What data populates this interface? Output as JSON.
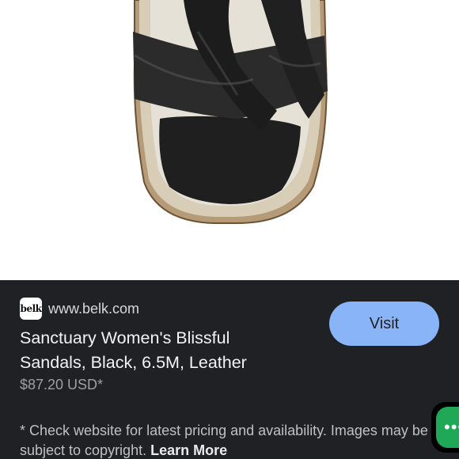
{
  "source": {
    "favicon_text": "belk",
    "domain": "www.belk.com"
  },
  "product": {
    "title": "Sanctuary Women's Blissful Sandals, Black, 6.5M, Leather",
    "price": "$87.20 USD*"
  },
  "visit_button": {
    "label": "Visit"
  },
  "disclaimer": {
    "text": "* Check website for latest pricing and availability. Images may be subject to copyright. ",
    "link_label": "Learn More"
  },
  "fab": {
    "icon": "chat-bubble-icon",
    "glyph": "•••"
  },
  "colors": {
    "panel_bg": "#202124",
    "button_bg": "#8ab4f8",
    "fab_green": "#1fa855"
  }
}
